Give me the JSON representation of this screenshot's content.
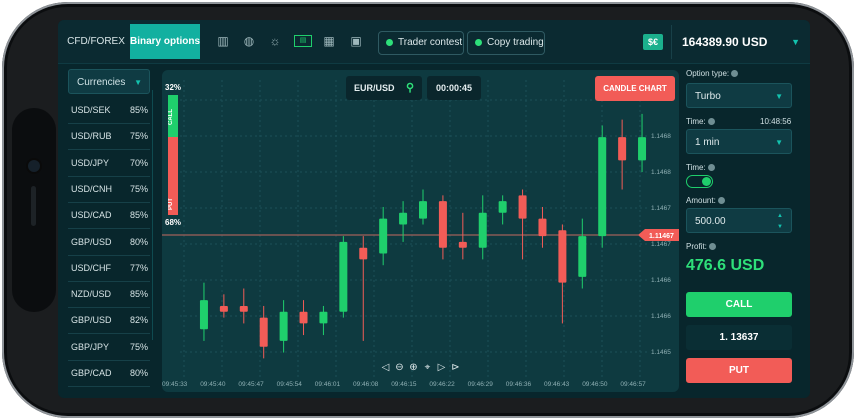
{
  "topbar": {
    "tabs": [
      "CFD/FOREX",
      "Binary options"
    ],
    "icons": [
      "bar-chart-icon",
      "globe-hand-icon",
      "lightbulb-icon",
      "ticket-icon",
      "analytics-icon",
      "calendar-icon"
    ],
    "pills": [
      "Trader contest",
      "Copy trading"
    ],
    "wallet_icon": "$€",
    "balance": "164389.90 USD"
  },
  "currencies": {
    "label": "Currencies",
    "pairs": [
      {
        "name": "USD/SEK",
        "pct": "85%"
      },
      {
        "name": "USD/RUB",
        "pct": "75%"
      },
      {
        "name": "USD/JPY",
        "pct": "70%"
      },
      {
        "name": "USD/CNH",
        "pct": "75%"
      },
      {
        "name": "USD/CAD",
        "pct": "85%"
      },
      {
        "name": "GBP/USD",
        "pct": "80%"
      },
      {
        "name": "USD/CHF",
        "pct": "77%"
      },
      {
        "name": "NZD/USD",
        "pct": "85%"
      },
      {
        "name": "GBP/USD",
        "pct": "82%"
      },
      {
        "name": "GBP/JPY",
        "pct": "75%"
      },
      {
        "name": "GBP/CAD",
        "pct": "80%"
      }
    ]
  },
  "chart": {
    "symbol": "EUR/USD",
    "timer": "00:00:45",
    "candle_btn": "CANDLE CHART",
    "call_pct": "32%",
    "put_pct": "68%",
    "call_label": "CALL",
    "put_label": "PUT",
    "price_levels": [
      "1.1468",
      "1.1468",
      "1.1467",
      "1.1467",
      "1.1466",
      "1.1466",
      "1.1465"
    ],
    "current_price_tag": "1.11467",
    "time_labels": [
      "09:45:33",
      "09:45:40",
      "09:45:47",
      "09:45:54",
      "09:46:01",
      "09:46:08",
      "09:46:15",
      "09:46:22",
      "09:46:29",
      "09:46:36",
      "09:46:43",
      "09:46:50",
      "09:46:57"
    ],
    "nav": [
      "◀",
      "🔍-",
      "🔍+",
      "✛",
      "▶",
      "▶|"
    ],
    "candles": [
      {
        "o": 1.14657,
        "c": 1.14662,
        "h": 1.14665,
        "l": 1.14655,
        "up": true
      },
      {
        "o": 1.14661,
        "c": 1.1466,
        "h": 1.14663,
        "l": 1.14659,
        "up": false
      },
      {
        "o": 1.14661,
        "c": 1.1466,
        "h": 1.14664,
        "l": 1.14658,
        "up": false
      },
      {
        "o": 1.14659,
        "c": 1.14654,
        "h": 1.14661,
        "l": 1.14652,
        "up": false
      },
      {
        "o": 1.14655,
        "c": 1.1466,
        "h": 1.14662,
        "l": 1.14653,
        "up": true
      },
      {
        "o": 1.1466,
        "c": 1.14658,
        "h": 1.14662,
        "l": 1.14656,
        "up": false
      },
      {
        "o": 1.14658,
        "c": 1.1466,
        "h": 1.14661,
        "l": 1.14656,
        "up": true
      },
      {
        "o": 1.1466,
        "c": 1.14672,
        "h": 1.14673,
        "l": 1.14659,
        "up": true
      },
      {
        "o": 1.14671,
        "c": 1.14669,
        "h": 1.14673,
        "l": 1.14655,
        "up": false
      },
      {
        "o": 1.1467,
        "c": 1.14676,
        "h": 1.14678,
        "l": 1.14668,
        "up": true
      },
      {
        "o": 1.14675,
        "c": 1.14677,
        "h": 1.14679,
        "l": 1.14672,
        "up": true
      },
      {
        "o": 1.14676,
        "c": 1.14679,
        "h": 1.14681,
        "l": 1.14675,
        "up": true
      },
      {
        "o": 1.14679,
        "c": 1.14671,
        "h": 1.1468,
        "l": 1.14669,
        "up": false
      },
      {
        "o": 1.14672,
        "c": 1.14671,
        "h": 1.14677,
        "l": 1.14669,
        "up": false
      },
      {
        "o": 1.14671,
        "c": 1.14677,
        "h": 1.1468,
        "l": 1.14669,
        "up": true
      },
      {
        "o": 1.14677,
        "c": 1.14679,
        "h": 1.1468,
        "l": 1.14675,
        "up": true
      },
      {
        "o": 1.1468,
        "c": 1.14676,
        "h": 1.14681,
        "l": 1.14669,
        "up": false
      },
      {
        "o": 1.14676,
        "c": 1.14673,
        "h": 1.14678,
        "l": 1.14671,
        "up": false
      },
      {
        "o": 1.14674,
        "c": 1.14665,
        "h": 1.14675,
        "l": 1.14658,
        "up": false
      },
      {
        "o": 1.14666,
        "c": 1.14673,
        "h": 1.14676,
        "l": 1.14664,
        "up": true
      },
      {
        "o": 1.14673,
        "c": 1.1469,
        "h": 1.14692,
        "l": 1.14671,
        "up": true
      },
      {
        "o": 1.1469,
        "c": 1.14686,
        "h": 1.14693,
        "l": 1.14681,
        "up": false
      },
      {
        "o": 1.14686,
        "c": 1.1469,
        "h": 1.14694,
        "l": 1.14684,
        "up": true
      }
    ],
    "ylim": [
      1.1465,
      1.14695
    ]
  },
  "panel": {
    "option_type_label": "Option type:",
    "option_type": "Turbo",
    "time_label": "Time:",
    "time_clock": "10:48:56",
    "time_value": "1 min",
    "toggle_label": "Time:",
    "amount_label": "Amount:",
    "amount": "500.00",
    "profit_label": "Profit:",
    "profit": "476.6 USD",
    "call": "CALL",
    "price": "1. 13637",
    "put": "PUT"
  },
  "colors": {
    "green": "#1fcf6c",
    "red": "#f25c57",
    "teal": "#12b0a0"
  }
}
